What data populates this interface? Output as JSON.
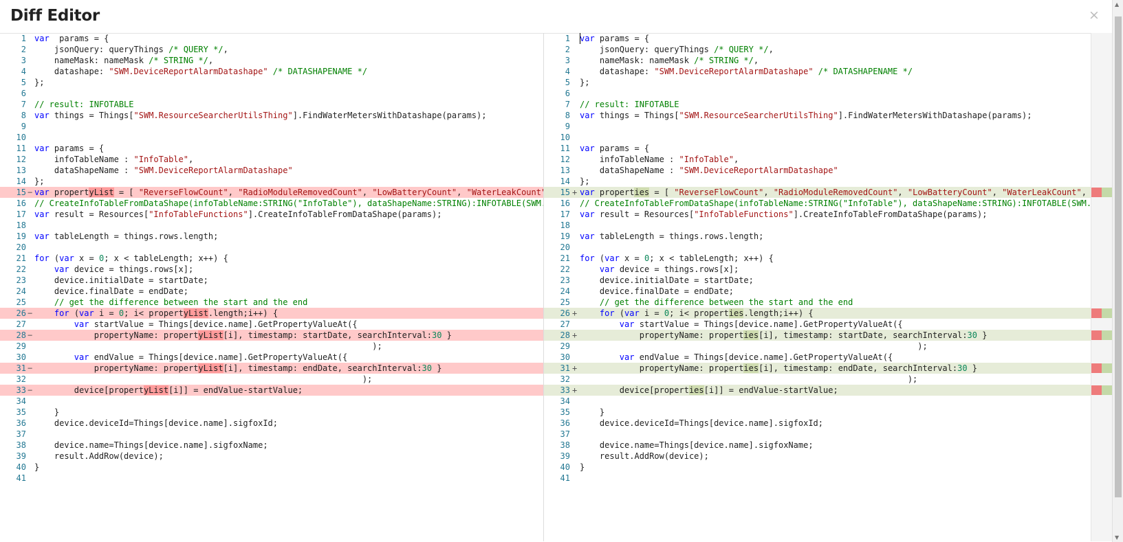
{
  "dialog": {
    "title": "Diff Editor",
    "close_glyph": "×"
  },
  "colors": {
    "deleted_line": "#ffc9c9",
    "added_line": "#e6ecd8",
    "deleted_word": "#ff9b9b",
    "added_word": "#cfdcb0",
    "keyword": "#0000ff",
    "string": "#a31515",
    "comment": "#008000",
    "number": "#098658",
    "line_number": "#237893"
  },
  "icons": {
    "close": "close-icon",
    "scroll_up": "chevron-up-icon",
    "scroll_down": "chevron-down-icon"
  },
  "left_lines": [
    {
      "n": "1",
      "m": "",
      "t": "",
      "segs": [
        [
          "k",
          "var"
        ],
        [
          "",
          "  params = {"
        ]
      ]
    },
    {
      "n": "2",
      "m": "",
      "t": "",
      "segs": [
        [
          "",
          "    jsonQuery: queryThings "
        ],
        [
          "c",
          "/* QUERY */"
        ],
        [
          "",
          ","
        ]
      ]
    },
    {
      "n": "3",
      "m": "",
      "t": "",
      "segs": [
        [
          "",
          "    nameMask: nameMask "
        ],
        [
          "c",
          "/* STRING */"
        ],
        [
          "",
          ","
        ]
      ]
    },
    {
      "n": "4",
      "m": "",
      "t": "",
      "segs": [
        [
          "",
          "    datashape: "
        ],
        [
          "s",
          "\"SWM.DeviceReportAlarmDatashape\""
        ],
        [
          "c",
          " /* DATASHAPENAME */"
        ]
      ]
    },
    {
      "n": "5",
      "m": "",
      "t": "",
      "segs": [
        [
          "",
          "};"
        ]
      ]
    },
    {
      "n": "6",
      "m": "",
      "t": "",
      "segs": []
    },
    {
      "n": "7",
      "m": "",
      "t": "",
      "segs": [
        [
          "c",
          "// result: INFOTABLE"
        ]
      ]
    },
    {
      "n": "8",
      "m": "",
      "t": "",
      "segs": [
        [
          "k",
          "var"
        ],
        [
          "",
          " things = Things["
        ],
        [
          "s",
          "\"SWM.ResourceSearcherUtilsThing\""
        ],
        [
          "",
          "].FindWaterMetersWithDatashape(params);"
        ]
      ]
    },
    {
      "n": "9",
      "m": "",
      "t": "",
      "segs": []
    },
    {
      "n": "10",
      "m": "",
      "t": "",
      "segs": []
    },
    {
      "n": "11",
      "m": "",
      "t": "",
      "segs": [
        [
          "k",
          "var"
        ],
        [
          "",
          " params = {"
        ]
      ]
    },
    {
      "n": "12",
      "m": "",
      "t": "",
      "segs": [
        [
          "",
          "    infoTableName : "
        ],
        [
          "s",
          "\"InfoTable\""
        ],
        [
          "",
          ","
        ]
      ]
    },
    {
      "n": "13",
      "m": "",
      "t": "",
      "segs": [
        [
          "",
          "    dataShapeName : "
        ],
        [
          "s",
          "\"SWM.DeviceReportAlarmDatashape\""
        ]
      ]
    },
    {
      "n": "14",
      "m": "",
      "t": "",
      "segs": [
        [
          "",
          "};"
        ]
      ]
    },
    {
      "n": "15",
      "m": "−",
      "t": "del",
      "segs": [
        [
          "k",
          "var"
        ],
        [
          "",
          " propert"
        ],
        [
          "hd",
          "yList"
        ],
        [
          "",
          " = [ "
        ],
        [
          "s",
          "\"ReverseFlowCount\""
        ],
        [
          "",
          ", "
        ],
        [
          "s",
          "\"RadioModuleRemovedCount\""
        ],
        [
          "",
          ", "
        ],
        [
          "s",
          "\"LowBatteryCount\""
        ],
        [
          "",
          ", "
        ],
        [
          "s",
          "\"WaterLeakCount\""
        ]
      ]
    },
    {
      "n": "16",
      "m": "",
      "t": "",
      "segs": [
        [
          "c",
          "// CreateInfoTableFromDataShape(infoTableName:STRING(\"InfoTable\"), dataShapeName:STRING):INFOTABLE(SWM."
        ]
      ]
    },
    {
      "n": "17",
      "m": "",
      "t": "",
      "segs": [
        [
          "k",
          "var"
        ],
        [
          "",
          " result = Resources["
        ],
        [
          "s",
          "\"InfoTableFunctions\""
        ],
        [
          "",
          "].CreateInfoTableFromDataShape(params);"
        ]
      ]
    },
    {
      "n": "18",
      "m": "",
      "t": "",
      "segs": []
    },
    {
      "n": "19",
      "m": "",
      "t": "",
      "segs": [
        [
          "k",
          "var"
        ],
        [
          "",
          " tableLength = things.rows.length;"
        ]
      ]
    },
    {
      "n": "20",
      "m": "",
      "t": "",
      "segs": []
    },
    {
      "n": "21",
      "m": "",
      "t": "",
      "segs": [
        [
          "k",
          "for"
        ],
        [
          "",
          " ("
        ],
        [
          "k",
          "var"
        ],
        [
          "",
          " x = "
        ],
        [
          "n",
          "0"
        ],
        [
          "",
          "; x < tableLength; x++) {"
        ]
      ]
    },
    {
      "n": "22",
      "m": "",
      "t": "",
      "segs": [
        [
          "",
          "    "
        ],
        [
          "k",
          "var"
        ],
        [
          "",
          " device = things.rows[x];"
        ]
      ]
    },
    {
      "n": "23",
      "m": "",
      "t": "",
      "segs": [
        [
          "",
          "    device.initialDate = startDate;"
        ]
      ]
    },
    {
      "n": "24",
      "m": "",
      "t": "",
      "segs": [
        [
          "",
          "    device.finalDate = endDate;"
        ]
      ]
    },
    {
      "n": "25",
      "m": "",
      "t": "",
      "segs": [
        [
          "c",
          "    // get the difference between the start and the end"
        ]
      ]
    },
    {
      "n": "26",
      "m": "−",
      "t": "del",
      "segs": [
        [
          "",
          "    "
        ],
        [
          "k",
          "for"
        ],
        [
          "",
          " ("
        ],
        [
          "k",
          "var"
        ],
        [
          "",
          " i = "
        ],
        [
          "n",
          "0"
        ],
        [
          "",
          "; i< propert"
        ],
        [
          "hd",
          "yList"
        ],
        [
          "",
          ".length;i++) {"
        ]
      ]
    },
    {
      "n": "27",
      "m": "",
      "t": "",
      "segs": [
        [
          "",
          "        "
        ],
        [
          "k",
          "var"
        ],
        [
          "",
          " startValue = Things[device.name].GetPropertyValueAt({"
        ]
      ]
    },
    {
      "n": "28",
      "m": "−",
      "t": "del",
      "segs": [
        [
          "",
          "            propertyName: propert"
        ],
        [
          "hd",
          "yList"
        ],
        [
          "",
          "[i], timestamp: startDate, searchInterval:"
        ],
        [
          "n",
          "30"
        ],
        [
          "",
          " }"
        ]
      ]
    },
    {
      "n": "29",
      "m": "",
      "t": "",
      "segs": [
        [
          "",
          "                                                                    );"
        ]
      ]
    },
    {
      "n": "30",
      "m": "",
      "t": "",
      "segs": [
        [
          "",
          "        "
        ],
        [
          "k",
          "var"
        ],
        [
          "",
          " endValue = Things[device.name].GetPropertyValueAt({"
        ]
      ]
    },
    {
      "n": "31",
      "m": "−",
      "t": "del",
      "segs": [
        [
          "",
          "            propertyName: propert"
        ],
        [
          "hd",
          "yList"
        ],
        [
          "",
          "[i], timestamp: endDate, searchInterval:"
        ],
        [
          "n",
          "30"
        ],
        [
          "",
          " }"
        ]
      ]
    },
    {
      "n": "32",
      "m": "",
      "t": "",
      "segs": [
        [
          "",
          "                                                                  );"
        ]
      ]
    },
    {
      "n": "33",
      "m": "−",
      "t": "del",
      "segs": [
        [
          "",
          "        device[propert"
        ],
        [
          "hd",
          "yList"
        ],
        [
          "",
          "[i]] = endValue-startValue;"
        ]
      ]
    },
    {
      "n": "34",
      "m": "",
      "t": "",
      "segs": []
    },
    {
      "n": "35",
      "m": "",
      "t": "",
      "segs": [
        [
          "",
          "    }"
        ]
      ]
    },
    {
      "n": "36",
      "m": "",
      "t": "",
      "segs": [
        [
          "",
          "    device.deviceId=Things[device.name].sigfoxId;"
        ]
      ]
    },
    {
      "n": "37",
      "m": "",
      "t": "",
      "segs": []
    },
    {
      "n": "38",
      "m": "",
      "t": "",
      "segs": [
        [
          "",
          "    device.name=Things[device.name].sigfoxName;"
        ]
      ]
    },
    {
      "n": "39",
      "m": "",
      "t": "",
      "segs": [
        [
          "",
          "    result.AddRow(device);"
        ]
      ]
    },
    {
      "n": "40",
      "m": "",
      "t": "",
      "segs": [
        [
          "",
          "}"
        ]
      ]
    },
    {
      "n": "41",
      "m": "",
      "t": "",
      "segs": []
    }
  ],
  "right_lines": [
    {
      "n": "1",
      "m": "",
      "t": "",
      "segs": [
        [
          "k",
          "var"
        ],
        [
          "",
          " params = {"
        ]
      ]
    },
    {
      "n": "2",
      "m": "",
      "t": "",
      "segs": [
        [
          "",
          "    jsonQuery: queryThings "
        ],
        [
          "c",
          "/* QUERY */"
        ],
        [
          "",
          ","
        ]
      ]
    },
    {
      "n": "3",
      "m": "",
      "t": "",
      "segs": [
        [
          "",
          "    nameMask: nameMask "
        ],
        [
          "c",
          "/* STRING */"
        ],
        [
          "",
          ","
        ]
      ]
    },
    {
      "n": "4",
      "m": "",
      "t": "",
      "segs": [
        [
          "",
          "    datashape: "
        ],
        [
          "s",
          "\"SWM.DeviceReportAlarmDatashape\""
        ],
        [
          "c",
          " /* DATASHAPENAME */"
        ]
      ]
    },
    {
      "n": "5",
      "m": "",
      "t": "",
      "segs": [
        [
          "",
          "};"
        ]
      ]
    },
    {
      "n": "6",
      "m": "",
      "t": "",
      "segs": []
    },
    {
      "n": "7",
      "m": "",
      "t": "",
      "segs": [
        [
          "c",
          "// result: INFOTABLE"
        ]
      ]
    },
    {
      "n": "8",
      "m": "",
      "t": "",
      "segs": [
        [
          "k",
          "var"
        ],
        [
          "",
          " things = Things["
        ],
        [
          "s",
          "\"SWM.ResourceSearcherUtilsThing\""
        ],
        [
          "",
          "].FindWaterMetersWithDatashape(params);"
        ]
      ]
    },
    {
      "n": "9",
      "m": "",
      "t": "",
      "segs": []
    },
    {
      "n": "10",
      "m": "",
      "t": "",
      "segs": []
    },
    {
      "n": "11",
      "m": "",
      "t": "",
      "segs": [
        [
          "k",
          "var"
        ],
        [
          "",
          " params = {"
        ]
      ]
    },
    {
      "n": "12",
      "m": "",
      "t": "",
      "segs": [
        [
          "",
          "    infoTableName : "
        ],
        [
          "s",
          "\"InfoTable\""
        ],
        [
          "",
          ","
        ]
      ]
    },
    {
      "n": "13",
      "m": "",
      "t": "",
      "segs": [
        [
          "",
          "    dataShapeName : "
        ],
        [
          "s",
          "\"SWM.DeviceReportAlarmDatashape\""
        ]
      ]
    },
    {
      "n": "14",
      "m": "",
      "t": "",
      "segs": [
        [
          "",
          "};"
        ]
      ]
    },
    {
      "n": "15",
      "m": "+",
      "t": "add",
      "segs": [
        [
          "k",
          "var"
        ],
        [
          "",
          " propert"
        ],
        [
          "ha",
          "ies"
        ],
        [
          "",
          " = [ "
        ],
        [
          "s",
          "\"ReverseFlowCount\""
        ],
        [
          "",
          ", "
        ],
        [
          "s",
          "\"RadioModuleRemovedCount\""
        ],
        [
          "",
          ", "
        ],
        [
          "s",
          "\"LowBatteryCount\""
        ],
        [
          "",
          ", "
        ],
        [
          "s",
          "\"WaterLeakCount\""
        ],
        [
          "",
          ", "
        ]
      ]
    },
    {
      "n": "16",
      "m": "",
      "t": "",
      "segs": [
        [
          "c",
          "// CreateInfoTableFromDataShape(infoTableName:STRING(\"InfoTable\"), dataShapeName:STRING):INFOTABLE(SWM."
        ]
      ]
    },
    {
      "n": "17",
      "m": "",
      "t": "",
      "segs": [
        [
          "k",
          "var"
        ],
        [
          "",
          " result = Resources["
        ],
        [
          "s",
          "\"InfoTableFunctions\""
        ],
        [
          "",
          "].CreateInfoTableFromDataShape(params);"
        ]
      ]
    },
    {
      "n": "18",
      "m": "",
      "t": "",
      "segs": []
    },
    {
      "n": "19",
      "m": "",
      "t": "",
      "segs": [
        [
          "k",
          "var"
        ],
        [
          "",
          " tableLength = things.rows.length;"
        ]
      ]
    },
    {
      "n": "20",
      "m": "",
      "t": "",
      "segs": []
    },
    {
      "n": "21",
      "m": "",
      "t": "",
      "segs": [
        [
          "k",
          "for"
        ],
        [
          "",
          " ("
        ],
        [
          "k",
          "var"
        ],
        [
          "",
          " x = "
        ],
        [
          "n",
          "0"
        ],
        [
          "",
          "; x < tableLength; x++) {"
        ]
      ]
    },
    {
      "n": "22",
      "m": "",
      "t": "",
      "segs": [
        [
          "",
          "    "
        ],
        [
          "k",
          "var"
        ],
        [
          "",
          " device = things.rows[x];"
        ]
      ]
    },
    {
      "n": "23",
      "m": "",
      "t": "",
      "segs": [
        [
          "",
          "    device.initialDate = startDate;"
        ]
      ]
    },
    {
      "n": "24",
      "m": "",
      "t": "",
      "segs": [
        [
          "",
          "    device.finalDate = endDate;"
        ]
      ]
    },
    {
      "n": "25",
      "m": "",
      "t": "",
      "segs": [
        [
          "c",
          "    // get the difference between the start and the end"
        ]
      ]
    },
    {
      "n": "26",
      "m": "+",
      "t": "add",
      "segs": [
        [
          "",
          "    "
        ],
        [
          "k",
          "for"
        ],
        [
          "",
          " ("
        ],
        [
          "k",
          "var"
        ],
        [
          "",
          " i = "
        ],
        [
          "n",
          "0"
        ],
        [
          "",
          "; i< propert"
        ],
        [
          "ha",
          "ies"
        ],
        [
          "",
          ".length;i++) {"
        ]
      ]
    },
    {
      "n": "27",
      "m": "",
      "t": "",
      "segs": [
        [
          "",
          "        "
        ],
        [
          "k",
          "var"
        ],
        [
          "",
          " startValue = Things[device.name].GetPropertyValueAt({"
        ]
      ]
    },
    {
      "n": "28",
      "m": "+",
      "t": "add",
      "segs": [
        [
          "",
          "            propertyName: propert"
        ],
        [
          "ha",
          "ies"
        ],
        [
          "",
          "[i], timestamp: startDate, searchInterval:"
        ],
        [
          "n",
          "30"
        ],
        [
          "",
          " }"
        ]
      ]
    },
    {
      "n": "29",
      "m": "",
      "t": "",
      "segs": [
        [
          "",
          "                                                                    );"
        ]
      ]
    },
    {
      "n": "30",
      "m": "",
      "t": "",
      "segs": [
        [
          "",
          "        "
        ],
        [
          "k",
          "var"
        ],
        [
          "",
          " endValue = Things[device.name].GetPropertyValueAt({"
        ]
      ]
    },
    {
      "n": "31",
      "m": "+",
      "t": "add",
      "segs": [
        [
          "",
          "            propertyName: propert"
        ],
        [
          "ha",
          "ies"
        ],
        [
          "",
          "[i], timestamp: endDate, searchInterval:"
        ],
        [
          "n",
          "30"
        ],
        [
          "",
          " }"
        ]
      ]
    },
    {
      "n": "32",
      "m": "",
      "t": "",
      "segs": [
        [
          "",
          "                                                                  );"
        ]
      ]
    },
    {
      "n": "33",
      "m": "+",
      "t": "add",
      "segs": [
        [
          "",
          "        device[propert"
        ],
        [
          "ha",
          "ies"
        ],
        [
          "",
          "[i]] = endValue-startValue;"
        ]
      ]
    },
    {
      "n": "34",
      "m": "",
      "t": "",
      "segs": []
    },
    {
      "n": "35",
      "m": "",
      "t": "",
      "segs": [
        [
          "",
          "    }"
        ]
      ]
    },
    {
      "n": "36",
      "m": "",
      "t": "",
      "segs": [
        [
          "",
          "    device.deviceId=Things[device.name].sigfoxId;"
        ]
      ]
    },
    {
      "n": "37",
      "m": "",
      "t": "",
      "segs": []
    },
    {
      "n": "38",
      "m": "",
      "t": "",
      "segs": [
        [
          "",
          "    device.name=Things[device.name].sigfoxName;"
        ]
      ]
    },
    {
      "n": "39",
      "m": "",
      "t": "",
      "segs": [
        [
          "",
          "    result.AddRow(device);"
        ]
      ]
    },
    {
      "n": "40",
      "m": "",
      "t": "",
      "segs": [
        [
          "",
          "}"
        ]
      ]
    },
    {
      "n": "41",
      "m": "",
      "t": "",
      "segs": []
    }
  ]
}
